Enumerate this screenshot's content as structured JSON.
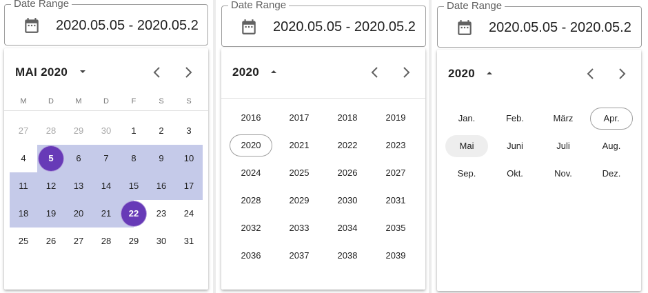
{
  "field": {
    "label": "Date Range",
    "value": "2020.05.05 - 2020.05.2"
  },
  "day_view": {
    "title": "MAI 2020",
    "weekdays": [
      "M",
      "D",
      "M",
      "D",
      "F",
      "S",
      "S"
    ],
    "weeks": [
      [
        "27",
        "28",
        "29",
        "30",
        "1",
        "2",
        "3"
      ],
      [
        "4",
        "5",
        "6",
        "7",
        "8",
        "9",
        "10"
      ],
      [
        "11",
        "12",
        "13",
        "14",
        "15",
        "16",
        "17"
      ],
      [
        "18",
        "19",
        "20",
        "21",
        "22",
        "23",
        "24"
      ],
      [
        "25",
        "26",
        "27",
        "28",
        "29",
        "30",
        "31"
      ]
    ],
    "range_start": "5",
    "range_end": "22"
  },
  "year_view": {
    "title": "2020",
    "years": [
      [
        "2016",
        "2017",
        "2018",
        "2019"
      ],
      [
        "2020",
        "2021",
        "2022",
        "2023"
      ],
      [
        "2024",
        "2025",
        "2026",
        "2027"
      ],
      [
        "2028",
        "2029",
        "2030",
        "2031"
      ],
      [
        "2032",
        "2033",
        "2034",
        "2035"
      ],
      [
        "2036",
        "2037",
        "2038",
        "2039"
      ]
    ],
    "selected_year": "2020"
  },
  "month_view": {
    "title": "2020",
    "months": [
      [
        "Jan.",
        "Feb.",
        "März",
        "Apr."
      ],
      [
        "Mai",
        "Juni",
        "Juli",
        "Aug."
      ],
      [
        "Sep.",
        "Okt.",
        "Nov.",
        "Dez."
      ]
    ],
    "outlined_month": "Apr.",
    "active_month": "Mai"
  },
  "colors": {
    "accent": "#673ab7",
    "range": "#c5cae9"
  },
  "icons": {
    "field": "calendar-icon",
    "caret": "caret-icon",
    "prev": "chevron-left-icon",
    "next": "chevron-right-icon"
  }
}
